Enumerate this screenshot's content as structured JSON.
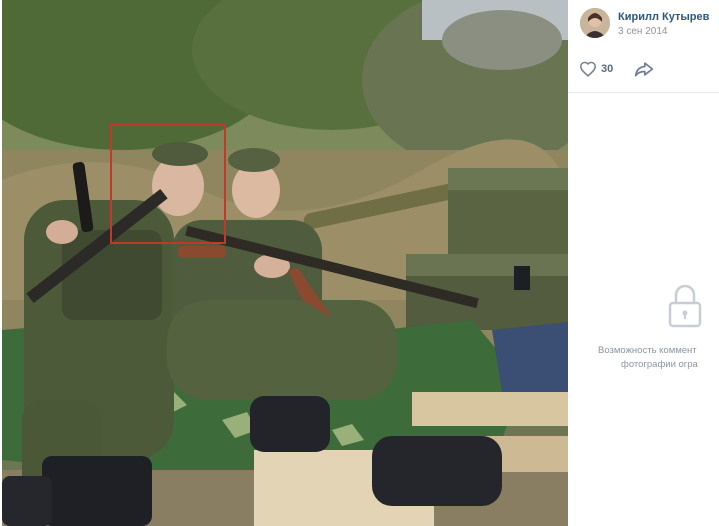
{
  "post": {
    "author_name": "Кирилл Кутырев",
    "date": "3 сен 2014",
    "likes": "30"
  },
  "icons": {
    "like": "heart-icon",
    "share": "share-arrow-icon",
    "lock": "lock-icon"
  },
  "comments_notice": {
    "line1": "Возможность коммент",
    "line2": "фотографии огра"
  },
  "colors": {
    "author_link": "#2a5885",
    "date": "#939393",
    "highlight_box": "#c0392b",
    "notice_text": "#8b96a3"
  }
}
